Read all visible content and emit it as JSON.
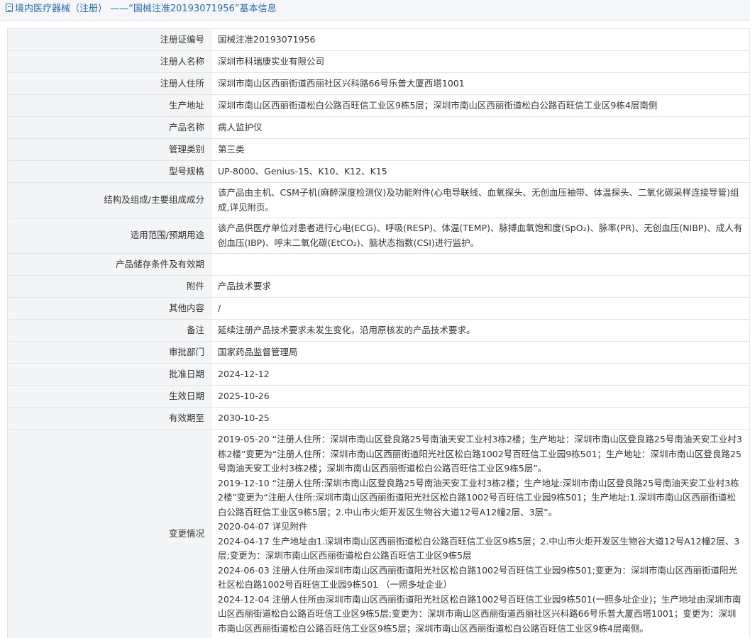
{
  "header": {
    "icon": "document-icon",
    "title": "境内医疗器械（注册） ——“国械注准20193071956”基本信息"
  },
  "rows": [
    {
      "label": "注册证编号",
      "value": "国械注准20193071956"
    },
    {
      "label": "注册人名称",
      "value": "深圳市科瑞康实业有限公司"
    },
    {
      "label": "注册人住所",
      "value": "深圳市南山区西丽街道西丽社区兴科路66号乐普大厦西塔1001"
    },
    {
      "label": "生产地址",
      "value": "深圳市南山区西丽街道松白公路百旺信工业区9栋5层；深圳市南山区西丽街道松白公路百旺信工业区9栋4层南侧"
    },
    {
      "label": "产品名称",
      "value": "病人监护仪"
    },
    {
      "label": "管理类别",
      "value": "第三类"
    },
    {
      "label": "型号规格",
      "value": "UP-8000、Genius-15、K10、K12、K15"
    },
    {
      "label": "结构及组成/主要组成成分",
      "value": "该产品由主机、CSM子机(麻醉深度检测仪)及功能附件(心电导联线、血氧探头、无创血压袖带、体温探头、二氧化碳采样连接导管)组成,详见附页。"
    },
    {
      "label": "适用范围/预期用途",
      "value": "该产品供医疗单位对患者进行心电(ECG)、呼吸(RESP)、体温(TEMP)、脉搏血氧饱和度(SpO₂)、脉率(PR)、无创血压(NIBP)、成人有创血压(IBP)、呼末二氧化碳(EtCO₂)、脑状态指数(CSI)进行监护。"
    },
    {
      "label": "产品储存条件及有效期",
      "value": ""
    },
    {
      "label": "附件",
      "value": "产品技术要求"
    },
    {
      "label": "其他内容",
      "value": "/"
    },
    {
      "label": "备注",
      "value": "延续注册产品技术要求未发生变化，沿用原核发的产品技术要求。"
    },
    {
      "label": "审批部门",
      "value": "国家药品监督管理局"
    },
    {
      "label": "批准日期",
      "value": "2024-12-12"
    },
    {
      "label": "生效日期",
      "value": "2025-10-26"
    },
    {
      "label": "有效期至",
      "value": "2030-10-25"
    }
  ],
  "changes": {
    "label": "变更情况",
    "entries": [
      "2019-05-20 “注册人住所：深圳市南山区登良路25号南油天安工业村3栋2楼；生产地址：深圳市南山区登良路25号南油天安工业村3栋2楼”变更为“注册人住所：深圳市南山区西丽街道阳光社区松白路1002号百旺信工业园9栋501；生产地址：深圳市南山区登良路25号南油天安工业村3栋2楼；深圳市南山区西丽街道松白公路百旺信工业区9栋5层”。",
      "2019-12-10 “注册人住所:深圳市南山区登良路25号南油天安工业村3栋2楼；生产地址:深圳市南山区登良路25号南油天安工业村3栋2楼”变更为“注册人住所:深圳市南山区西丽街道阳光社区松白路1002号百旺信工业园9栋501；生产地址:1.深圳市南山区西丽街道松白公路百旺信工业区9栋5层；2.中山市火炬开发区生物谷大道12号A12幢2层、3层”。",
      "2020-04-07 详见附件",
      "2024-04-17 生产地址由1.深圳市南山区西丽街道松白公路百旺信工业区9栋5层；2.中山市火炬开发区生物谷大道12号A12幢2层、3层;变更为：深圳市南山区西丽街道松白公路百旺信工业区9栋5层",
      "2024-06-03 注册人住所由深圳市南山区西丽街道阳光社区松白路1002号百旺信工业园9栋501;变更为：深圳市南山区西丽街道阳光社区松白路1002号百旺信工业园9栋501 （一照多址企业）",
      "2024-12-04 注册人住所由深圳市南山区西丽街道阳光社区松白路1002号百旺信工业园9栋501(一照多址企业)；生产地址由深圳市南山区西丽街道松白公路百旺信工业区9栋5层;变更为：深圳市南山区西丽街道西丽社区兴科路66号乐普大厦西塔1001；变更为：深圳市南山区西丽街道松白公路百旺信工业区9栋5层；深圳市南山区西丽街道松白公路百旺信工业区9栋4层南侧。"
    ]
  }
}
